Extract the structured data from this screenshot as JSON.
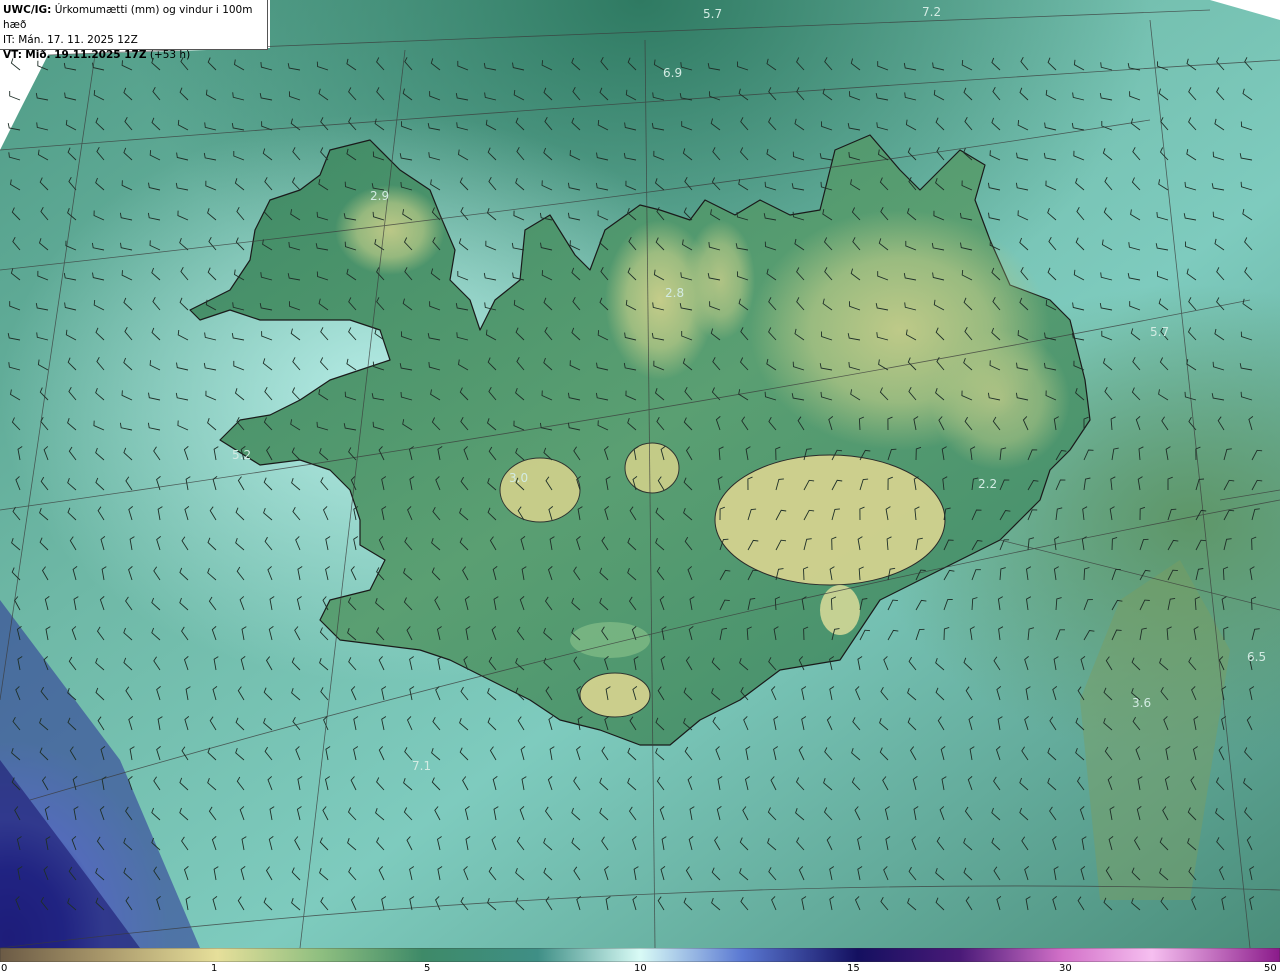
{
  "header": {
    "model": "UWC/IG:",
    "field": "Úrkomumætti (mm) og vindur i 100m hæð",
    "init_label": "IT:",
    "init_time": "Mán. 17. 11. 2025 12Z",
    "valid_label": "VT:",
    "valid_time": "Mið. 19.11.2025 17Z",
    "lead": "(+53 h)"
  },
  "map_values": [
    {
      "id": "v1",
      "text": "5.7"
    },
    {
      "id": "v2",
      "text": "7.2"
    },
    {
      "id": "v3",
      "text": "6.9"
    },
    {
      "id": "v4",
      "text": "2.8"
    },
    {
      "id": "v5",
      "text": "5.7"
    },
    {
      "id": "v6",
      "text": "3.0"
    },
    {
      "id": "v7",
      "text": "6.5"
    },
    {
      "id": "v8",
      "text": "3.6"
    },
    {
      "id": "v9",
      "text": "7.1"
    },
    {
      "id": "v10",
      "text": "2.9"
    },
    {
      "id": "v11",
      "text": "5.2"
    },
    {
      "id": "v12",
      "text": "2.2"
    }
  ],
  "colorbar": {
    "ticks": [
      "0",
      "1",
      "5",
      "10",
      "15",
      "30",
      "50"
    ],
    "colors": [
      "#7a6a52",
      "#b3a472",
      "#e8e19a",
      "#8fbf80",
      "#3e8a68",
      "#2f7a6a",
      "#5fb4a8",
      "#bff0ee",
      "#4b6fd0",
      "#1c1f8a",
      "#2b0a63",
      "#7a2a8a",
      "#d07ad0",
      "#f2b8ee",
      "#9a1a9a"
    ]
  }
}
